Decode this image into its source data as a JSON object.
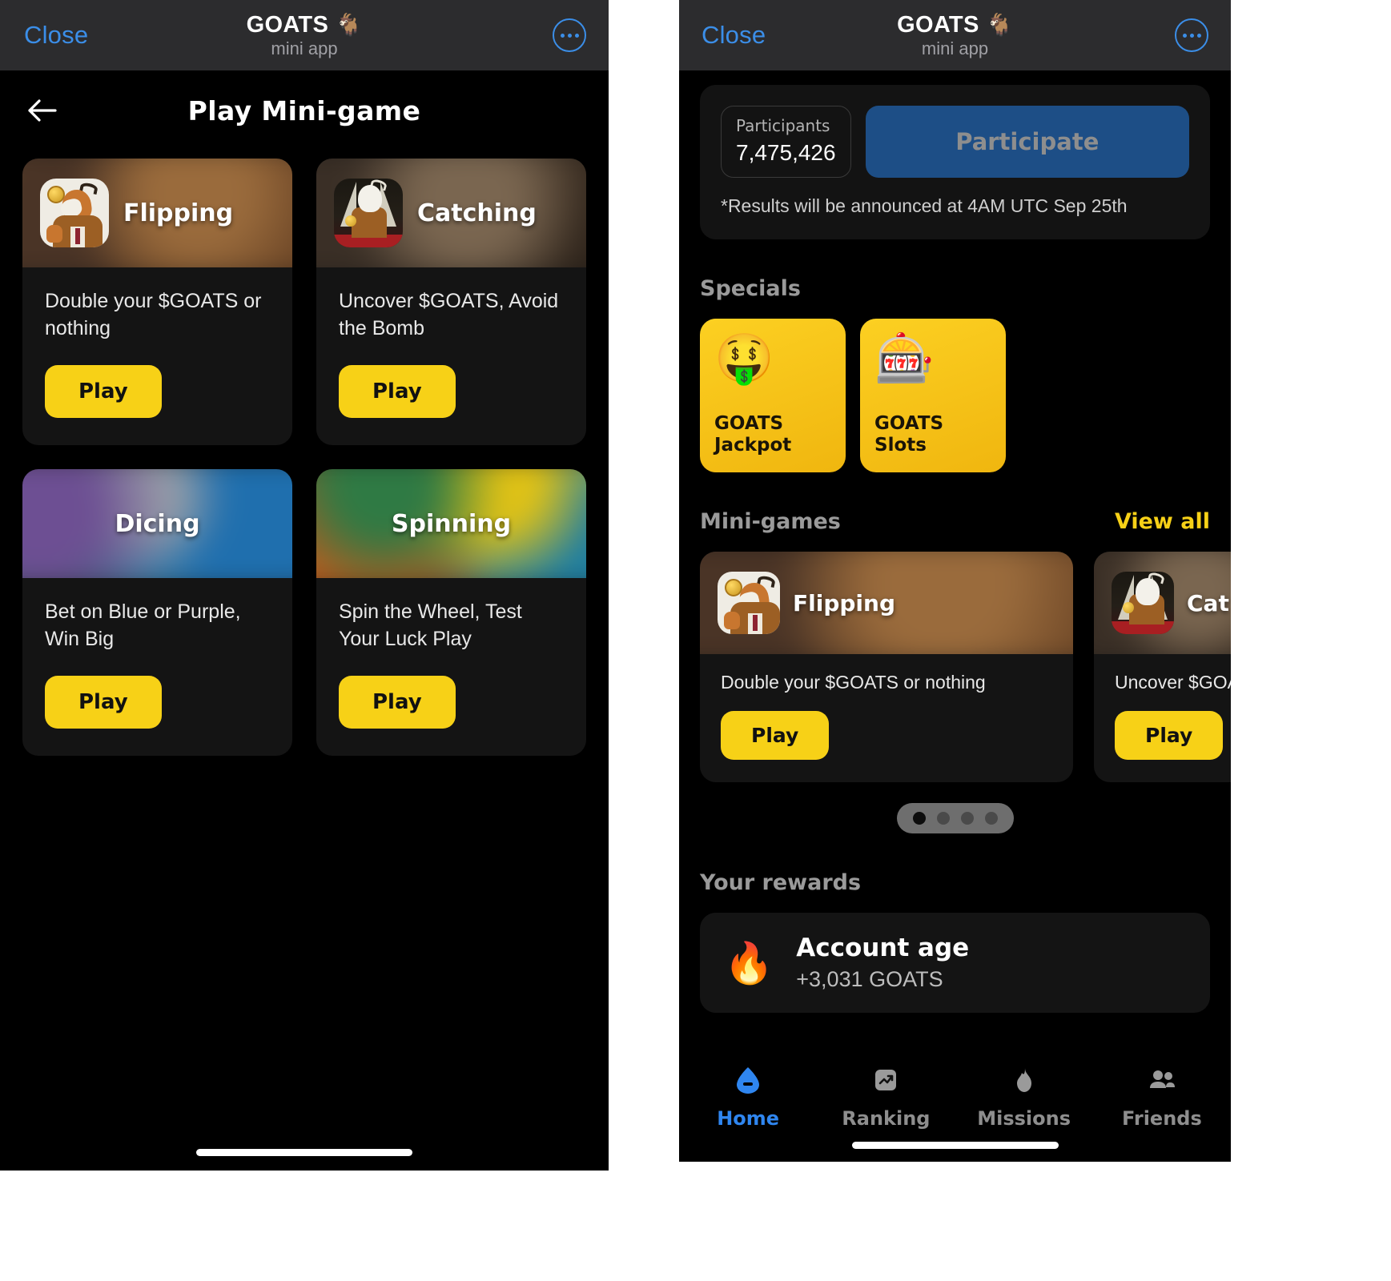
{
  "telegram_bar": {
    "close_label": "Close",
    "app_title": "GOATS",
    "app_title_emoji": "🐐",
    "app_subtitle": "mini app",
    "more_icon": "more-horizontal-icon"
  },
  "left_screen": {
    "header": {
      "back_icon": "arrow-left-icon",
      "title": "Play Mini-game"
    },
    "games": [
      {
        "name": "Flipping",
        "description": "Double your $GOATS or nothing",
        "play_label": "Play",
        "icon": "goat-coin-flip-icon",
        "has_icon": true,
        "bg_class": "bg-flip"
      },
      {
        "name": "Catching",
        "description": "Uncover $GOATS, Avoid the Bomb",
        "play_label": "Play",
        "icon": "goat-red-carpet-icon",
        "has_icon": true,
        "bg_class": "bg-catch"
      },
      {
        "name": "Dicing",
        "description": "Bet on Blue or Purple, Win Big",
        "play_label": "Play",
        "icon": "",
        "has_icon": false,
        "bg_class": "bg-dice"
      },
      {
        "name": "Spinning",
        "description": "Spin the Wheel, Test Your Luck Play",
        "play_label": "Play",
        "icon": "",
        "has_icon": false,
        "bg_class": "bg-spin"
      }
    ]
  },
  "right_screen": {
    "participation": {
      "participants_label": "Participants",
      "participants_count": "7,475,426",
      "participate_label": "Participate",
      "note": "*Results will be announced at 4AM UTC Sep 25th"
    },
    "specials": {
      "title": "Specials",
      "cards": [
        {
          "emoji": "🤑",
          "emoji_name": "money-face-icon",
          "name": "GOATS\nJackpot",
          "line1": "GOATS",
          "line2": "Jackpot"
        },
        {
          "emoji": "🎰",
          "emoji_name": "slot-machine-icon",
          "name": "GOATS\nSlots",
          "line1": "GOATS",
          "line2": "Slots"
        }
      ]
    },
    "minigames": {
      "title": "Mini-games",
      "view_all_label": "View all",
      "cards": [
        {
          "name": "Flipping",
          "description": "Double your $GOATS or nothing",
          "play_label": "Play",
          "bg_class": "bg-flip"
        },
        {
          "name": "Cat",
          "description": "Uncover $GOATS",
          "play_label": "Play",
          "bg_class": "bg-catch"
        }
      ],
      "pagination": {
        "total": 4,
        "active_index": 0
      }
    },
    "rewards": {
      "title": "Your rewards",
      "items": [
        {
          "emoji": "🔥",
          "emoji_name": "fire-icon",
          "name": "Account age",
          "amount": "+3,031 GOATS"
        }
      ]
    },
    "tabbar": {
      "tabs": [
        {
          "label": "Home",
          "icon": "home-icon",
          "active": true
        },
        {
          "label": "Ranking",
          "icon": "trending-up-icon",
          "active": false
        },
        {
          "label": "Missions",
          "icon": "flame-icon",
          "active": false
        },
        {
          "label": "Friends",
          "icon": "people-icon",
          "active": false
        }
      ]
    }
  },
  "colors": {
    "accent_yellow": "#f7d117",
    "telegram_blue": "#3b8ee8",
    "participate_blue": "#1d4e86",
    "card_bg": "#141414",
    "page_bg": "#000000"
  }
}
